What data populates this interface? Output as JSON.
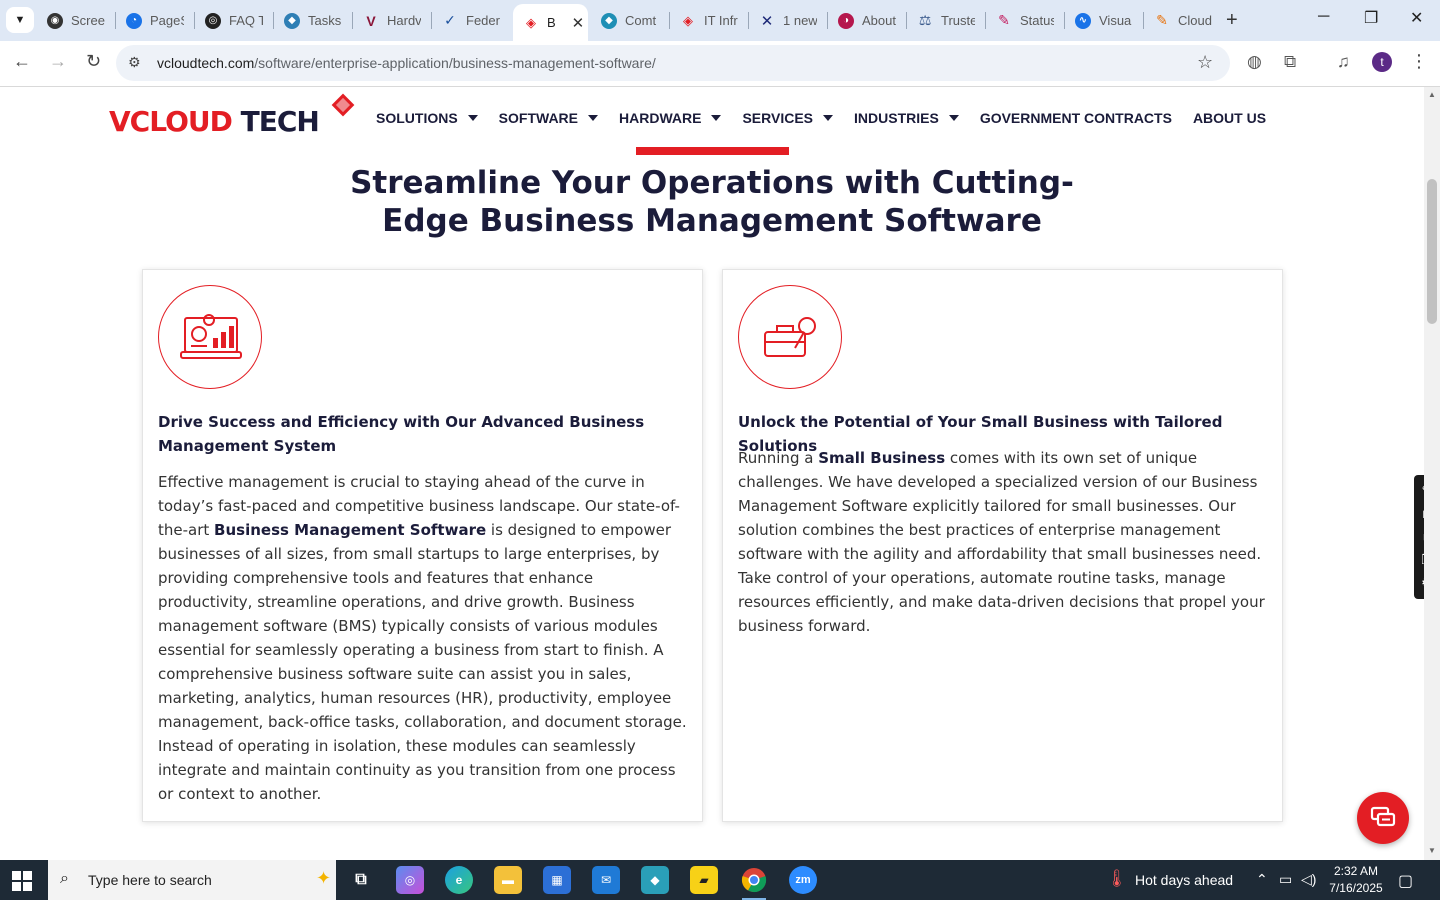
{
  "browser": {
    "tabs": [
      {
        "label": "Scree",
        "icon": "screencastify-icon",
        "color": "#333333"
      },
      {
        "label": "PageS",
        "icon": "pagespeed-icon",
        "color": "#1a73e8"
      },
      {
        "label": "FAQ T",
        "icon": "faq-icon",
        "color": "#222222"
      },
      {
        "label": "Tasks",
        "icon": "tasks-icon",
        "color": "#2f7fb5"
      },
      {
        "label": "Hardv",
        "icon": "hardware-v-icon",
        "color": "#8a1538"
      },
      {
        "label": "Feder",
        "icon": "federal-icon",
        "color": "#1a4f9c"
      },
      {
        "label": "B",
        "icon": "vcloud-icon",
        "color": "#e31e24",
        "active": true
      },
      {
        "label": "Comt",
        "icon": "comt-icon",
        "color": "#1f8fb5"
      },
      {
        "label": "IT Infr",
        "icon": "it-infra-icon",
        "color": "#e31e24"
      },
      {
        "label": "1 new",
        "icon": "x-mail-icon",
        "color": "#1e2a78"
      },
      {
        "label": "About",
        "icon": "about-icon",
        "color": "#b5174d"
      },
      {
        "label": "Truste",
        "icon": "trust-scale-icon",
        "color": "#3a5a8c"
      },
      {
        "label": "Status",
        "icon": "status-icon",
        "color": "#c2185b"
      },
      {
        "label": "Visua",
        "icon": "visual-icon",
        "color": "#1a73e8"
      },
      {
        "label": "Cloud",
        "icon": "cloud-icon",
        "color": "#e8710a"
      }
    ],
    "url_domain": "vcloudtech.com",
    "url_path": "/software/enterprise-application/business-management-software/"
  },
  "site": {
    "logo": {
      "red": "VCLOUD",
      "navy": " TECH"
    },
    "nav": [
      {
        "label": "SOLUTIONS",
        "dropdown": true
      },
      {
        "label": "SOFTWARE",
        "dropdown": true
      },
      {
        "label": "HARDWARE",
        "dropdown": true
      },
      {
        "label": "SERVICES",
        "dropdown": true
      },
      {
        "label": "INDUSTRIES",
        "dropdown": true
      },
      {
        "label": "GOVERNMENT CONTRACTS",
        "dropdown": false
      },
      {
        "label": "ABOUT US",
        "dropdown": false
      }
    ],
    "headline_line1": "Streamline Your Operations with Cutting-",
    "headline_line2": "Edge Business Management Software",
    "cards": [
      {
        "title": "Drive Success and Efficiency with Our Advanced Business Management System",
        "body_1": "Effective management is crucial to staying ahead of the curve in today’s fast-paced and competitive business landscape. Our state-of-the-art ",
        "body_bold": "Business Management Software",
        "body_2": " is designed to empower businesses of all sizes, from small startups to large enterprises, by providing comprehensive tools and features that enhance productivity, streamline operations, and drive growth. Business management software (BMS) typically consists of various modules essential for seamlessly operating a business from start to finish. A comprehensive business software suite can assist you in sales, marketing, analytics, human resources (HR), productivity, employee management, back-office tasks, collaboration, and document storage. Instead of operating in isolation, these modules can seamlessly integrate and maintain continuity as you transition from one process or context to another."
      },
      {
        "title": "Unlock the Potential of Your Small Business with Tailored Solutions",
        "body_1": "Running a ",
        "body_bold": "Small Business",
        "body_2": " comes with its own set of unique challenges. We have developed a specialized version of our Business Management Software explicitly tailored for small businesses. Our solution combines the best practices of enterprise management software with the agility and affordability that small businesses need. Take control of your operations, automate routine tasks, manage resources efficiently, and make data-driven decisions that propel your business forward."
      }
    ]
  },
  "taskbar": {
    "search_placeholder": "Type here to search",
    "weather": "Hot days ahead",
    "time": "2:32 AM",
    "date": "7/16/2025"
  },
  "colors": {
    "brand_red": "#e31e24",
    "brand_navy": "#1b1c3a"
  }
}
